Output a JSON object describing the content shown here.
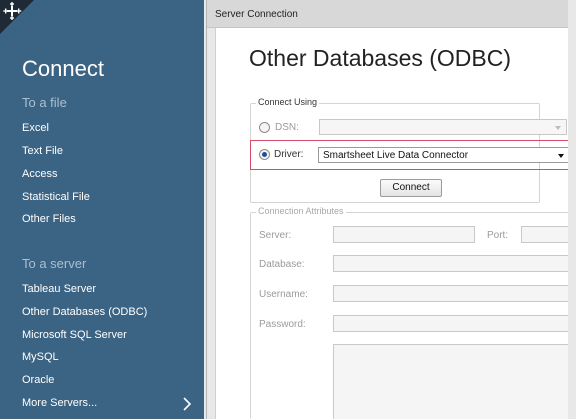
{
  "sidebar": {
    "title": "Connect",
    "file_section": "To a file",
    "file_items": [
      "Excel",
      "Text File",
      "Access",
      "Statistical File",
      "Other Files"
    ],
    "server_section": "To a server",
    "server_items": [
      "Tableau Server",
      "Other Databases (ODBC)",
      "Microsoft SQL Server",
      "MySQL",
      "Oracle",
      "More Servers..."
    ]
  },
  "dialog": {
    "window_title": "Server Connection",
    "heading": "Other Databases (ODBC)",
    "connect_using": {
      "legend": "Connect Using",
      "dsn_label": "DSN:",
      "dsn_value": "",
      "driver_label": "Driver:",
      "driver_value": "Smartsheet Live Data Connector",
      "selected": "driver",
      "connect_button": "Connect"
    },
    "connection_attributes": {
      "legend": "Connection Attributes",
      "server_label": "Server:",
      "port_label": "Port:",
      "database_label": "Database:",
      "username_label": "Username:",
      "password_label": "Password:"
    }
  },
  "colors": {
    "sidebar_bg": "#3b6383",
    "section_head": "#a9c0d3",
    "highlight": "#d64a6c",
    "radio_fill": "#1e4f9c"
  }
}
